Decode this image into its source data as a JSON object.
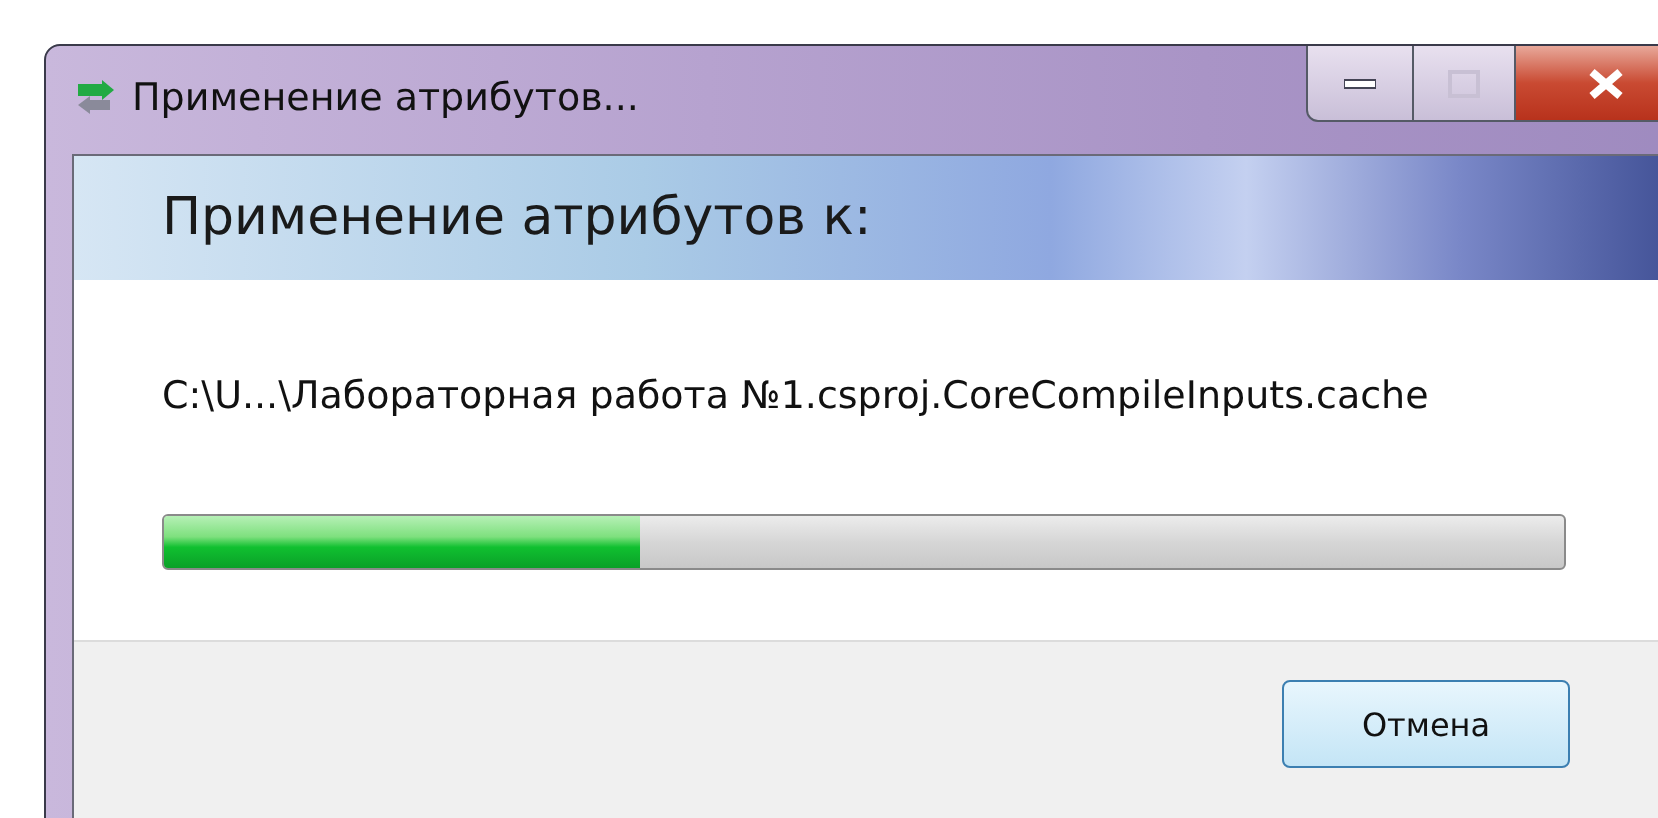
{
  "window": {
    "title": "Применение атрибутов..."
  },
  "heading": "Применение атрибутов к:",
  "file_path": "C:\\U...\\Лабораторная работа №1.csproj.CoreCompileInputs.cache",
  "progress": {
    "level": 0.34
  },
  "buttons": [
    "Отмена"
  ]
}
